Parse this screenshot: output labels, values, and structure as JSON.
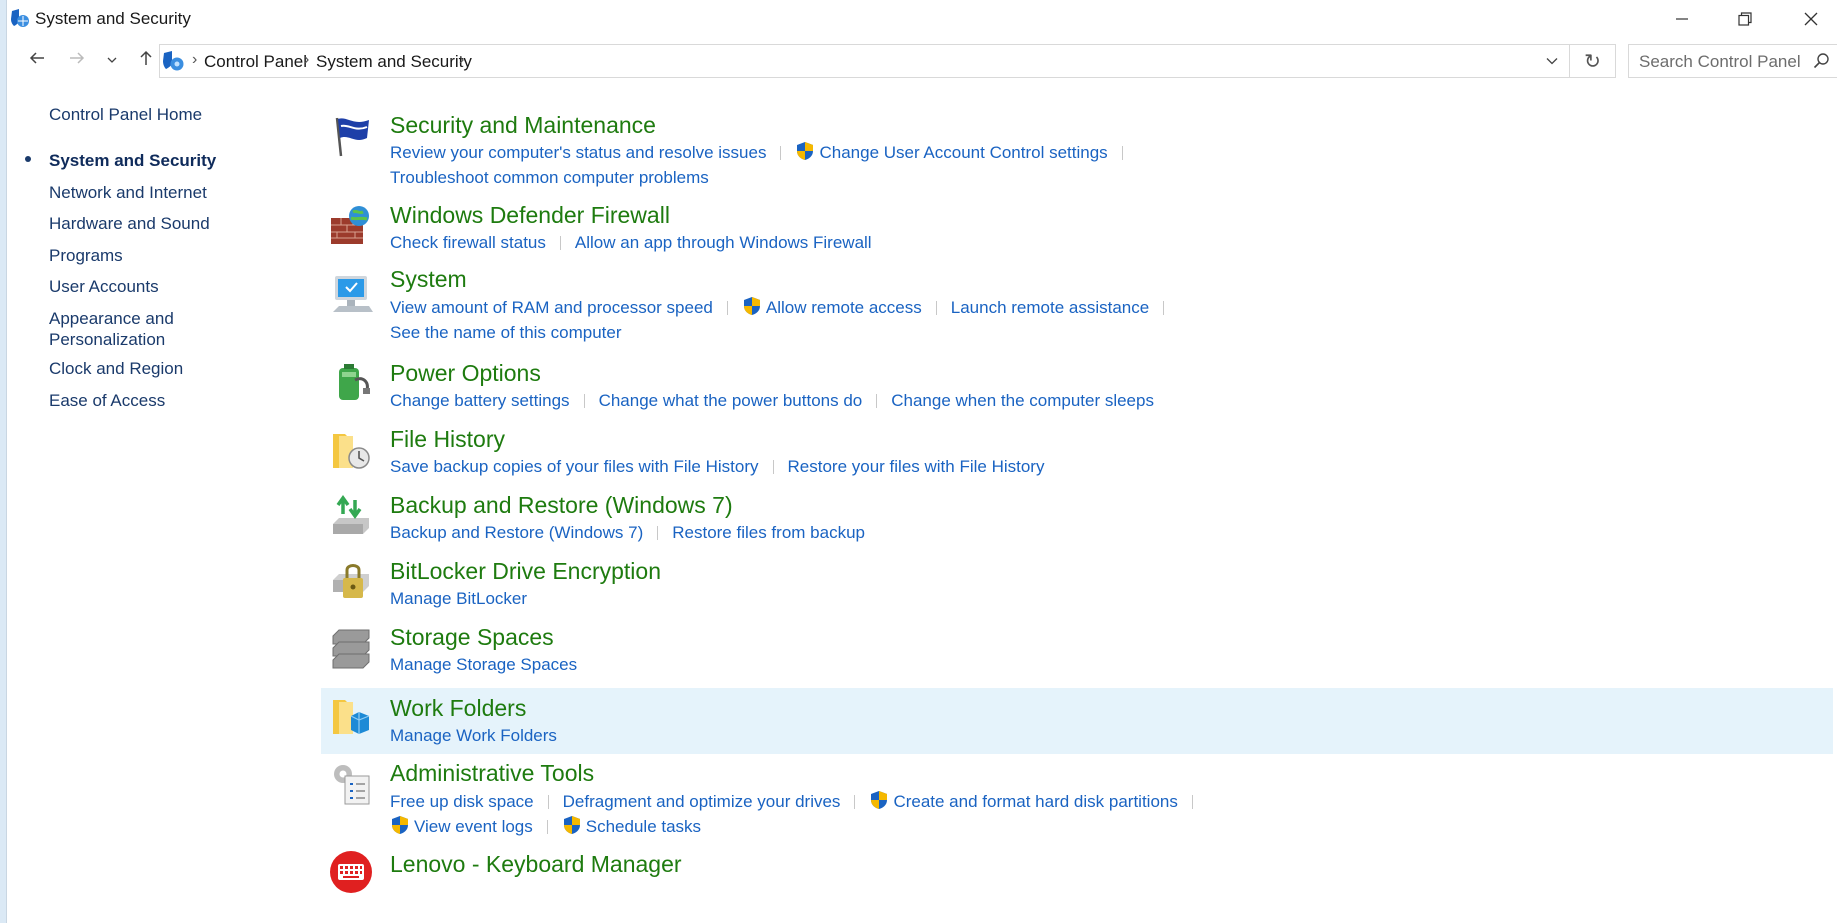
{
  "window": {
    "title": "System and Security",
    "controls": {
      "minimize": "minimize-icon",
      "restore": "restore-icon",
      "close": "close-icon"
    }
  },
  "address": {
    "crumbs": [
      "Control Panel",
      "System and Security"
    ],
    "search_placeholder": "Search Control Panel"
  },
  "sidebar": {
    "home": "Control Panel Home",
    "items": [
      {
        "label": "System and Security",
        "active": true
      },
      {
        "label": "Network and Internet"
      },
      {
        "label": "Hardware and Sound"
      },
      {
        "label": "Programs"
      },
      {
        "label": "User Accounts"
      },
      {
        "label": "Appearance and Personalization"
      },
      {
        "label": "Clock and Region"
      },
      {
        "label": "Ease of Access"
      }
    ]
  },
  "categories": [
    {
      "title": "Security and Maintenance",
      "icon": "flag-icon",
      "links": [
        "Review your computer's status and resolve issues",
        "Change User Account Control settings",
        "Troubleshoot common computer problems"
      ]
    },
    {
      "title": "Windows Defender Firewall",
      "icon": "firewall-icon",
      "links": [
        "Check firewall status",
        "Allow an app through Windows Firewall"
      ]
    },
    {
      "title": "System",
      "icon": "computer-icon",
      "links": [
        "View amount of RAM and processor speed",
        "Allow remote access",
        "Launch remote assistance",
        "See the name of this computer"
      ]
    },
    {
      "title": "Power Options",
      "icon": "battery-icon",
      "links": [
        "Change battery settings",
        "Change what the power buttons do",
        "Change when the computer sleeps"
      ]
    },
    {
      "title": "File History",
      "icon": "file-history-icon",
      "links": [
        "Save backup copies of your files with File History",
        "Restore your files with File History"
      ]
    },
    {
      "title": "Backup and Restore (Windows 7)",
      "icon": "backup-icon",
      "links": [
        "Backup and Restore (Windows 7)",
        "Restore files from backup"
      ]
    },
    {
      "title": "BitLocker Drive Encryption",
      "icon": "bitlocker-icon",
      "links": [
        "Manage BitLocker"
      ]
    },
    {
      "title": "Storage Spaces",
      "icon": "storage-icon",
      "links": [
        "Manage Storage Spaces"
      ]
    },
    {
      "title": "Work Folders",
      "icon": "work-folders-icon",
      "links": [
        "Manage Work Folders"
      ]
    },
    {
      "title": "Administrative Tools",
      "icon": "admin-tools-icon",
      "links": [
        "Free up disk space",
        "Defragment and optimize your drives",
        "Create and format hard disk partitions",
        "View event logs",
        "Schedule tasks"
      ]
    },
    {
      "title": "Lenovo - Keyboard Manager",
      "icon": "keyboard-icon",
      "links": []
    }
  ],
  "colors": {
    "title_green": "#1e7b0f",
    "link_blue": "#1a63c2",
    "highlight": "#e5f3fb"
  }
}
